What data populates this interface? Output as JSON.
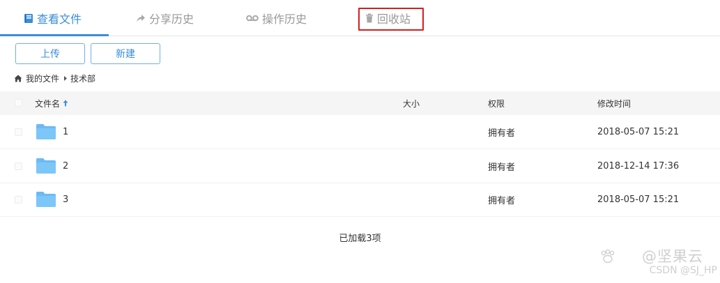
{
  "tabs": [
    {
      "label": "查看文件",
      "icon": "book-icon",
      "active": true
    },
    {
      "label": "分享历史",
      "icon": "share-arrow-icon",
      "active": false
    },
    {
      "label": "操作历史",
      "icon": "voicemail-icon",
      "active": false
    },
    {
      "label": "回收站",
      "icon": "trash-icon",
      "active": false,
      "highlighted": true
    }
  ],
  "toolbar": {
    "upload_label": "上传",
    "new_label": "新建"
  },
  "breadcrumb": {
    "home_icon": "home-icon",
    "root": "我的文件",
    "current": "技术部"
  },
  "table": {
    "columns": {
      "name": "文件名",
      "size": "大小",
      "permission": "权限",
      "modified": "修改时间"
    },
    "sort": {
      "column": "name",
      "direction": "ascending"
    },
    "rows": [
      {
        "name": "1",
        "size": "",
        "permission": "拥有者",
        "modified": "2018-05-07 15:21"
      },
      {
        "name": "2",
        "size": "",
        "permission": "拥有者",
        "modified": "2018-12-14 17:36"
      },
      {
        "name": "3",
        "size": "",
        "permission": "拥有者",
        "modified": "2018-05-07 15:21"
      }
    ]
  },
  "status": {
    "loaded": "已加载3项"
  },
  "watermark": {
    "line1": "@坚果云",
    "line2": "CSDN @SJ_HP"
  },
  "colors": {
    "accent": "#3a8ed8",
    "highlight_border": "#d21f1f",
    "folder": "#6cbaf4"
  }
}
